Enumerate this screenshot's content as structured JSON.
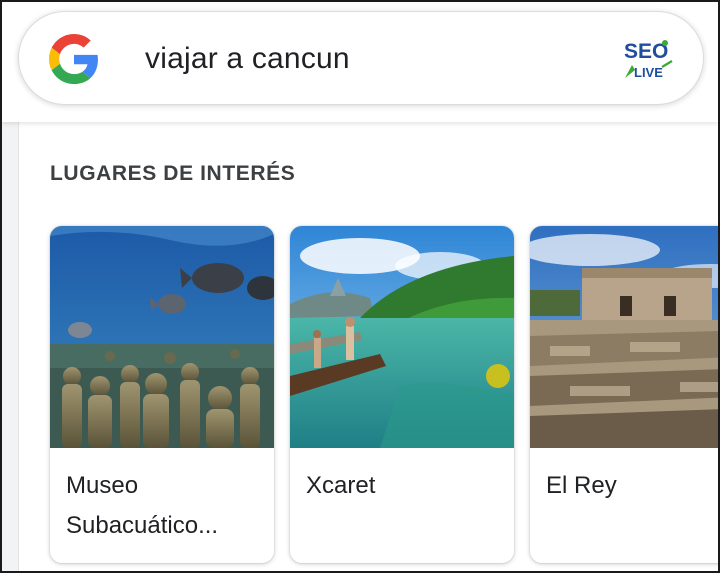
{
  "search": {
    "query": "viajar a cancun",
    "logo_icon": "google-g-logo-icon",
    "badge_icon": "seo-alive-logo-icon"
  },
  "section": {
    "title": "LUGARES DE INTERÉS"
  },
  "places": [
    {
      "name": "Museo Subacuático...",
      "image": "underwater-statues-photo"
    },
    {
      "name": "Xcaret",
      "image": "xcaret-lagoon-photo"
    },
    {
      "name": "El Rey",
      "image": "el-rey-ruins-photo"
    }
  ],
  "colors": {
    "google_blue": "#4285F4",
    "google_red": "#EA4335",
    "google_yellow": "#FBBC05",
    "google_green": "#34A853",
    "seo_blue": "#1f4e9c",
    "seo_green": "#3aaa35"
  }
}
